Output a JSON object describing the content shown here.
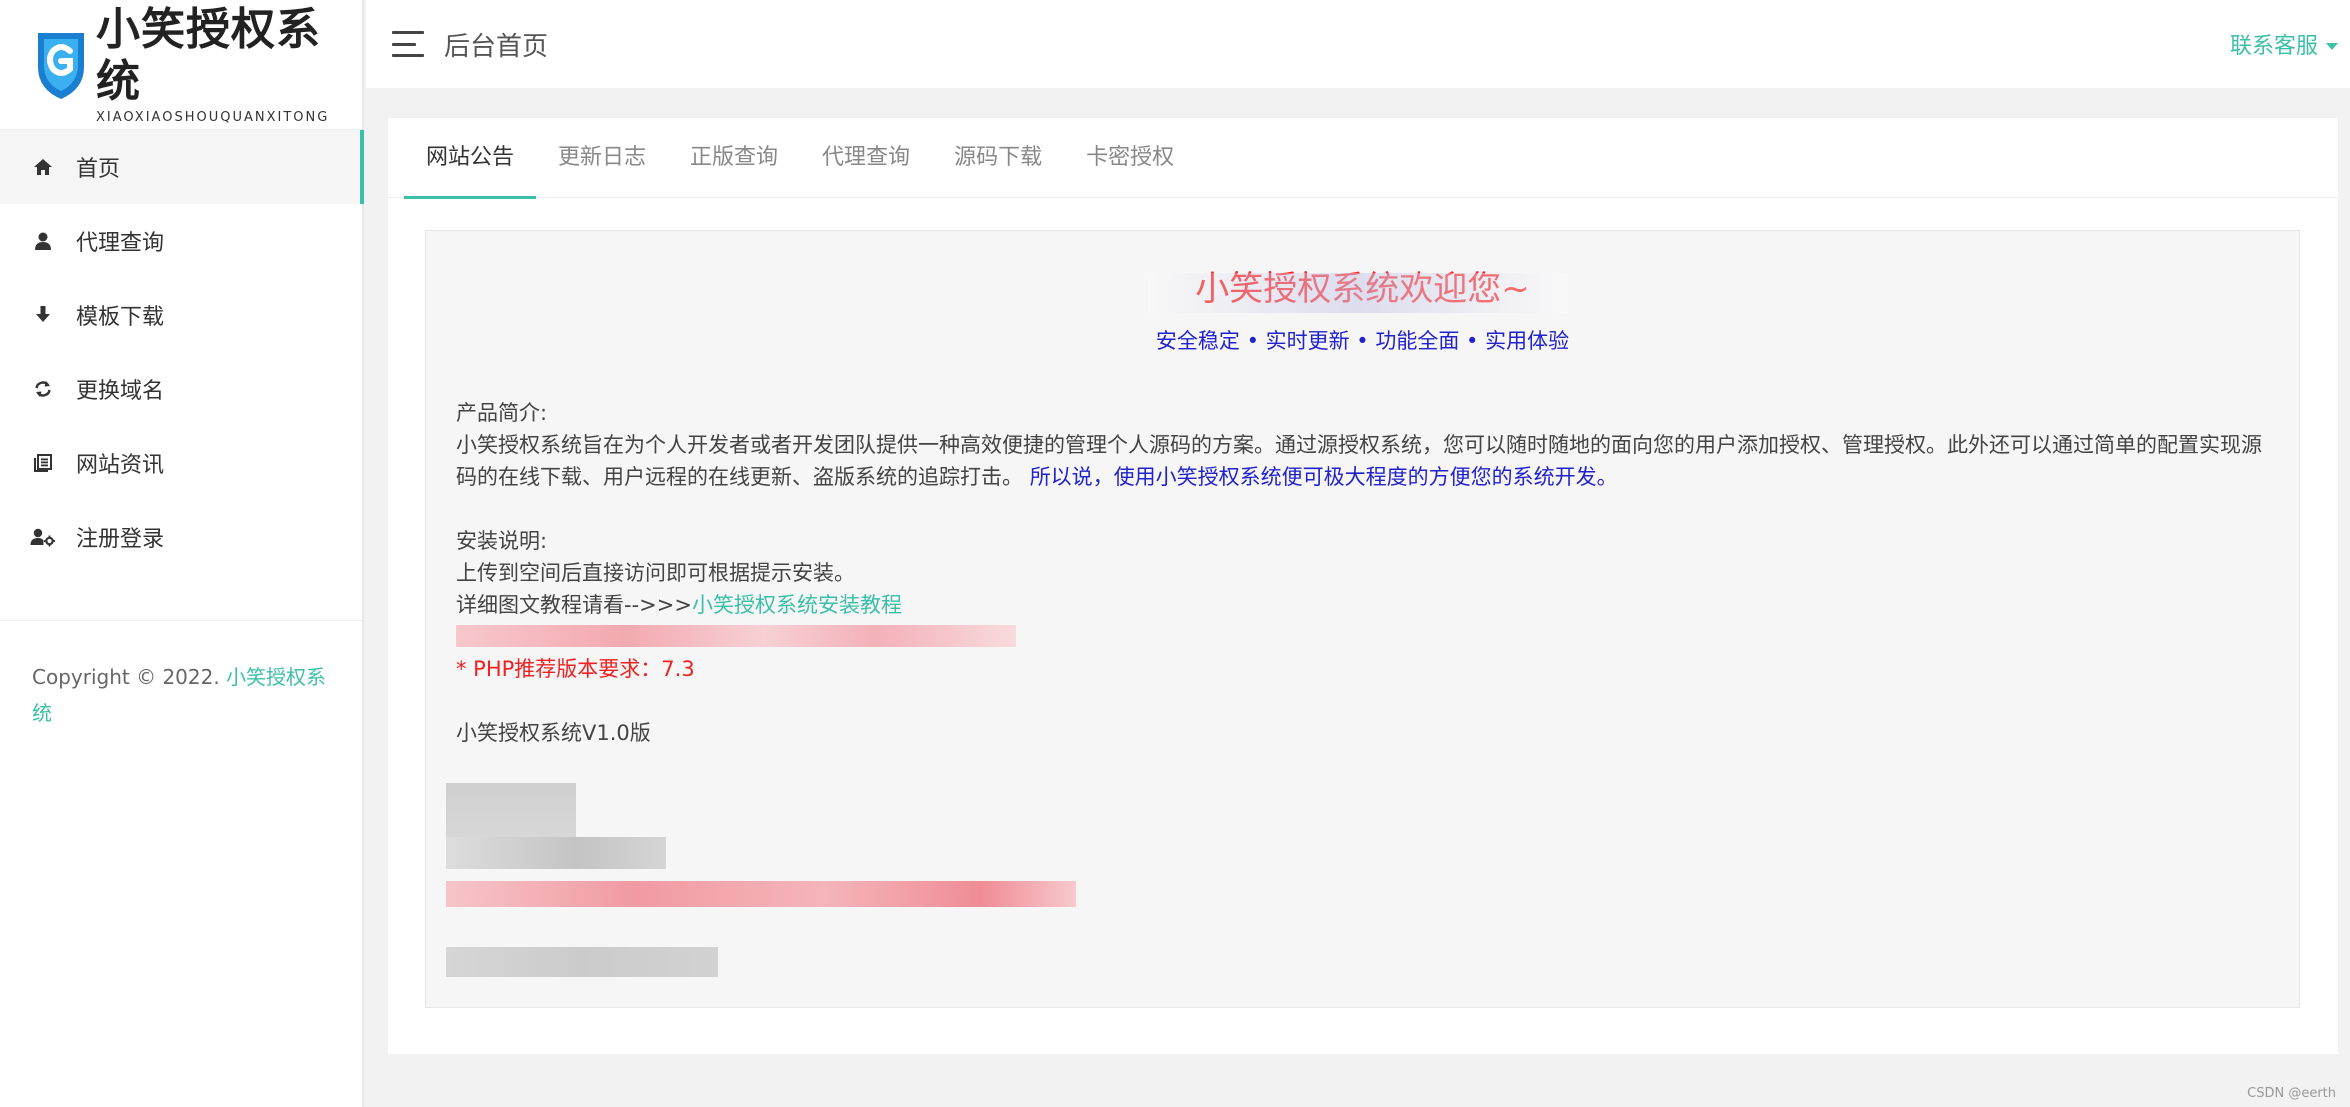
{
  "sidebar": {
    "logo_title": "小笑授权系统",
    "logo_sub": "XIAOXIAOSHOUQUANXITONG",
    "items": [
      {
        "label": "首页",
        "icon": "home-icon",
        "active": true
      },
      {
        "label": "代理查询",
        "icon": "user-icon"
      },
      {
        "label": "模板下载",
        "icon": "download-icon"
      },
      {
        "label": "更换域名",
        "icon": "refresh-icon"
      },
      {
        "label": "网站资讯",
        "icon": "news-icon"
      },
      {
        "label": "注册登录",
        "icon": "user-settings-icon"
      }
    ],
    "copyright_prefix": "Copyright © 2022.",
    "copyright_brand": "小笑授权系统"
  },
  "header": {
    "title": "后台首页",
    "contact": "联系客服"
  },
  "tabs": [
    "网站公告",
    "更新日志",
    "正版查询",
    "代理查询",
    "源码下载",
    "卡密授权"
  ],
  "notice": {
    "welcome": "小笑授权系统欢迎您~",
    "tagline": "安全稳定 • 实时更新 • 功能全面 • 实用体验",
    "intro_heading": "产品简介:",
    "intro_body": "小笑授权系统旨在为个人开发者或者开发团队提供一种高效便捷的管理个人源码的方案。通过源授权系统，您可以随时随地的面向您的用户添加授权、管理授权。此外还可以通过简单的配置实现源码的在线下载、用户远程的在线更新、盗版系统的追踪打击。",
    "intro_highlight": "所以说，使用小笑授权系统便可极大程度的方便您的系统开发。",
    "install_heading": "安装说明:",
    "install_line1": "上传到空间后直接访问即可根据提示安装。",
    "install_line2_prefix": "详细图文教程请看-->>>",
    "install_link": "小笑授权系统安装教程",
    "note_php": "* PHP推荐版本要求：7.3",
    "version": "小笑授权系统V1.0版"
  },
  "watermark": "CSDN @eerth",
  "colors": {
    "accent": "#3cbfa8",
    "welcome_red": "#ff2222",
    "link_blue": "#2222cc"
  }
}
